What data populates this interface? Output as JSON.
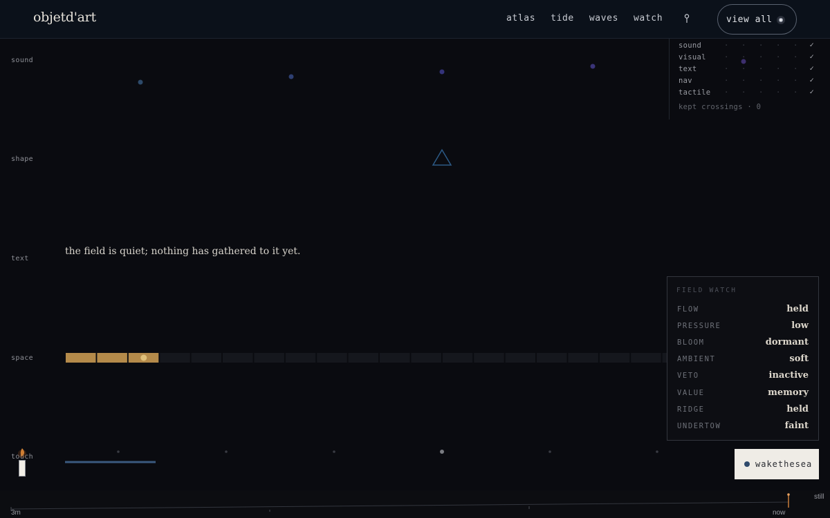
{
  "header": {
    "logo": "objetd'art",
    "nav": [
      "atlas",
      "tide",
      "waves",
      "watch"
    ],
    "view_all_label": "view all"
  },
  "rows": [
    "sound",
    "shape",
    "text",
    "space",
    "touch"
  ],
  "legend": {
    "items": [
      {
        "label": "sound",
        "check": "✓"
      },
      {
        "label": "visual",
        "check": "✓"
      },
      {
        "label": "text",
        "check": "✓"
      },
      {
        "label": "nav",
        "check": "✓"
      },
      {
        "label": "tactile",
        "check": "✓"
      }
    ],
    "dots": "·",
    "footer": "kept crossings · 0"
  },
  "quiet_text": "the field is quiet; nothing has gathered to it yet.",
  "space_bar": {
    "filled_segments": 3,
    "total_segments": 20,
    "fill_color": "#b48a4a",
    "empty_color": "#15171d"
  },
  "field_watch": {
    "title": "FIELD WATCH",
    "rows": [
      {
        "key": "FLOW",
        "value": "held"
      },
      {
        "key": "PRESSURE",
        "value": "low"
      },
      {
        "key": "BLOOM",
        "value": "dormant"
      },
      {
        "key": "AMBIENT",
        "value": "soft"
      },
      {
        "key": "VETO",
        "value": "inactive"
      },
      {
        "key": "VALUE",
        "value": "memory"
      },
      {
        "key": "RIDGE",
        "value": "held"
      },
      {
        "key": "UNDERTOW",
        "value": "faint"
      }
    ]
  },
  "wake_button": "wakethesea",
  "timeline": {
    "start_label": "3m",
    "end_label": "now",
    "status": "still"
  },
  "colors": {
    "accent_blue": "#2f4a6c",
    "accent_gold": "#b48a4a",
    "dot_purple": "#3a3478"
  }
}
